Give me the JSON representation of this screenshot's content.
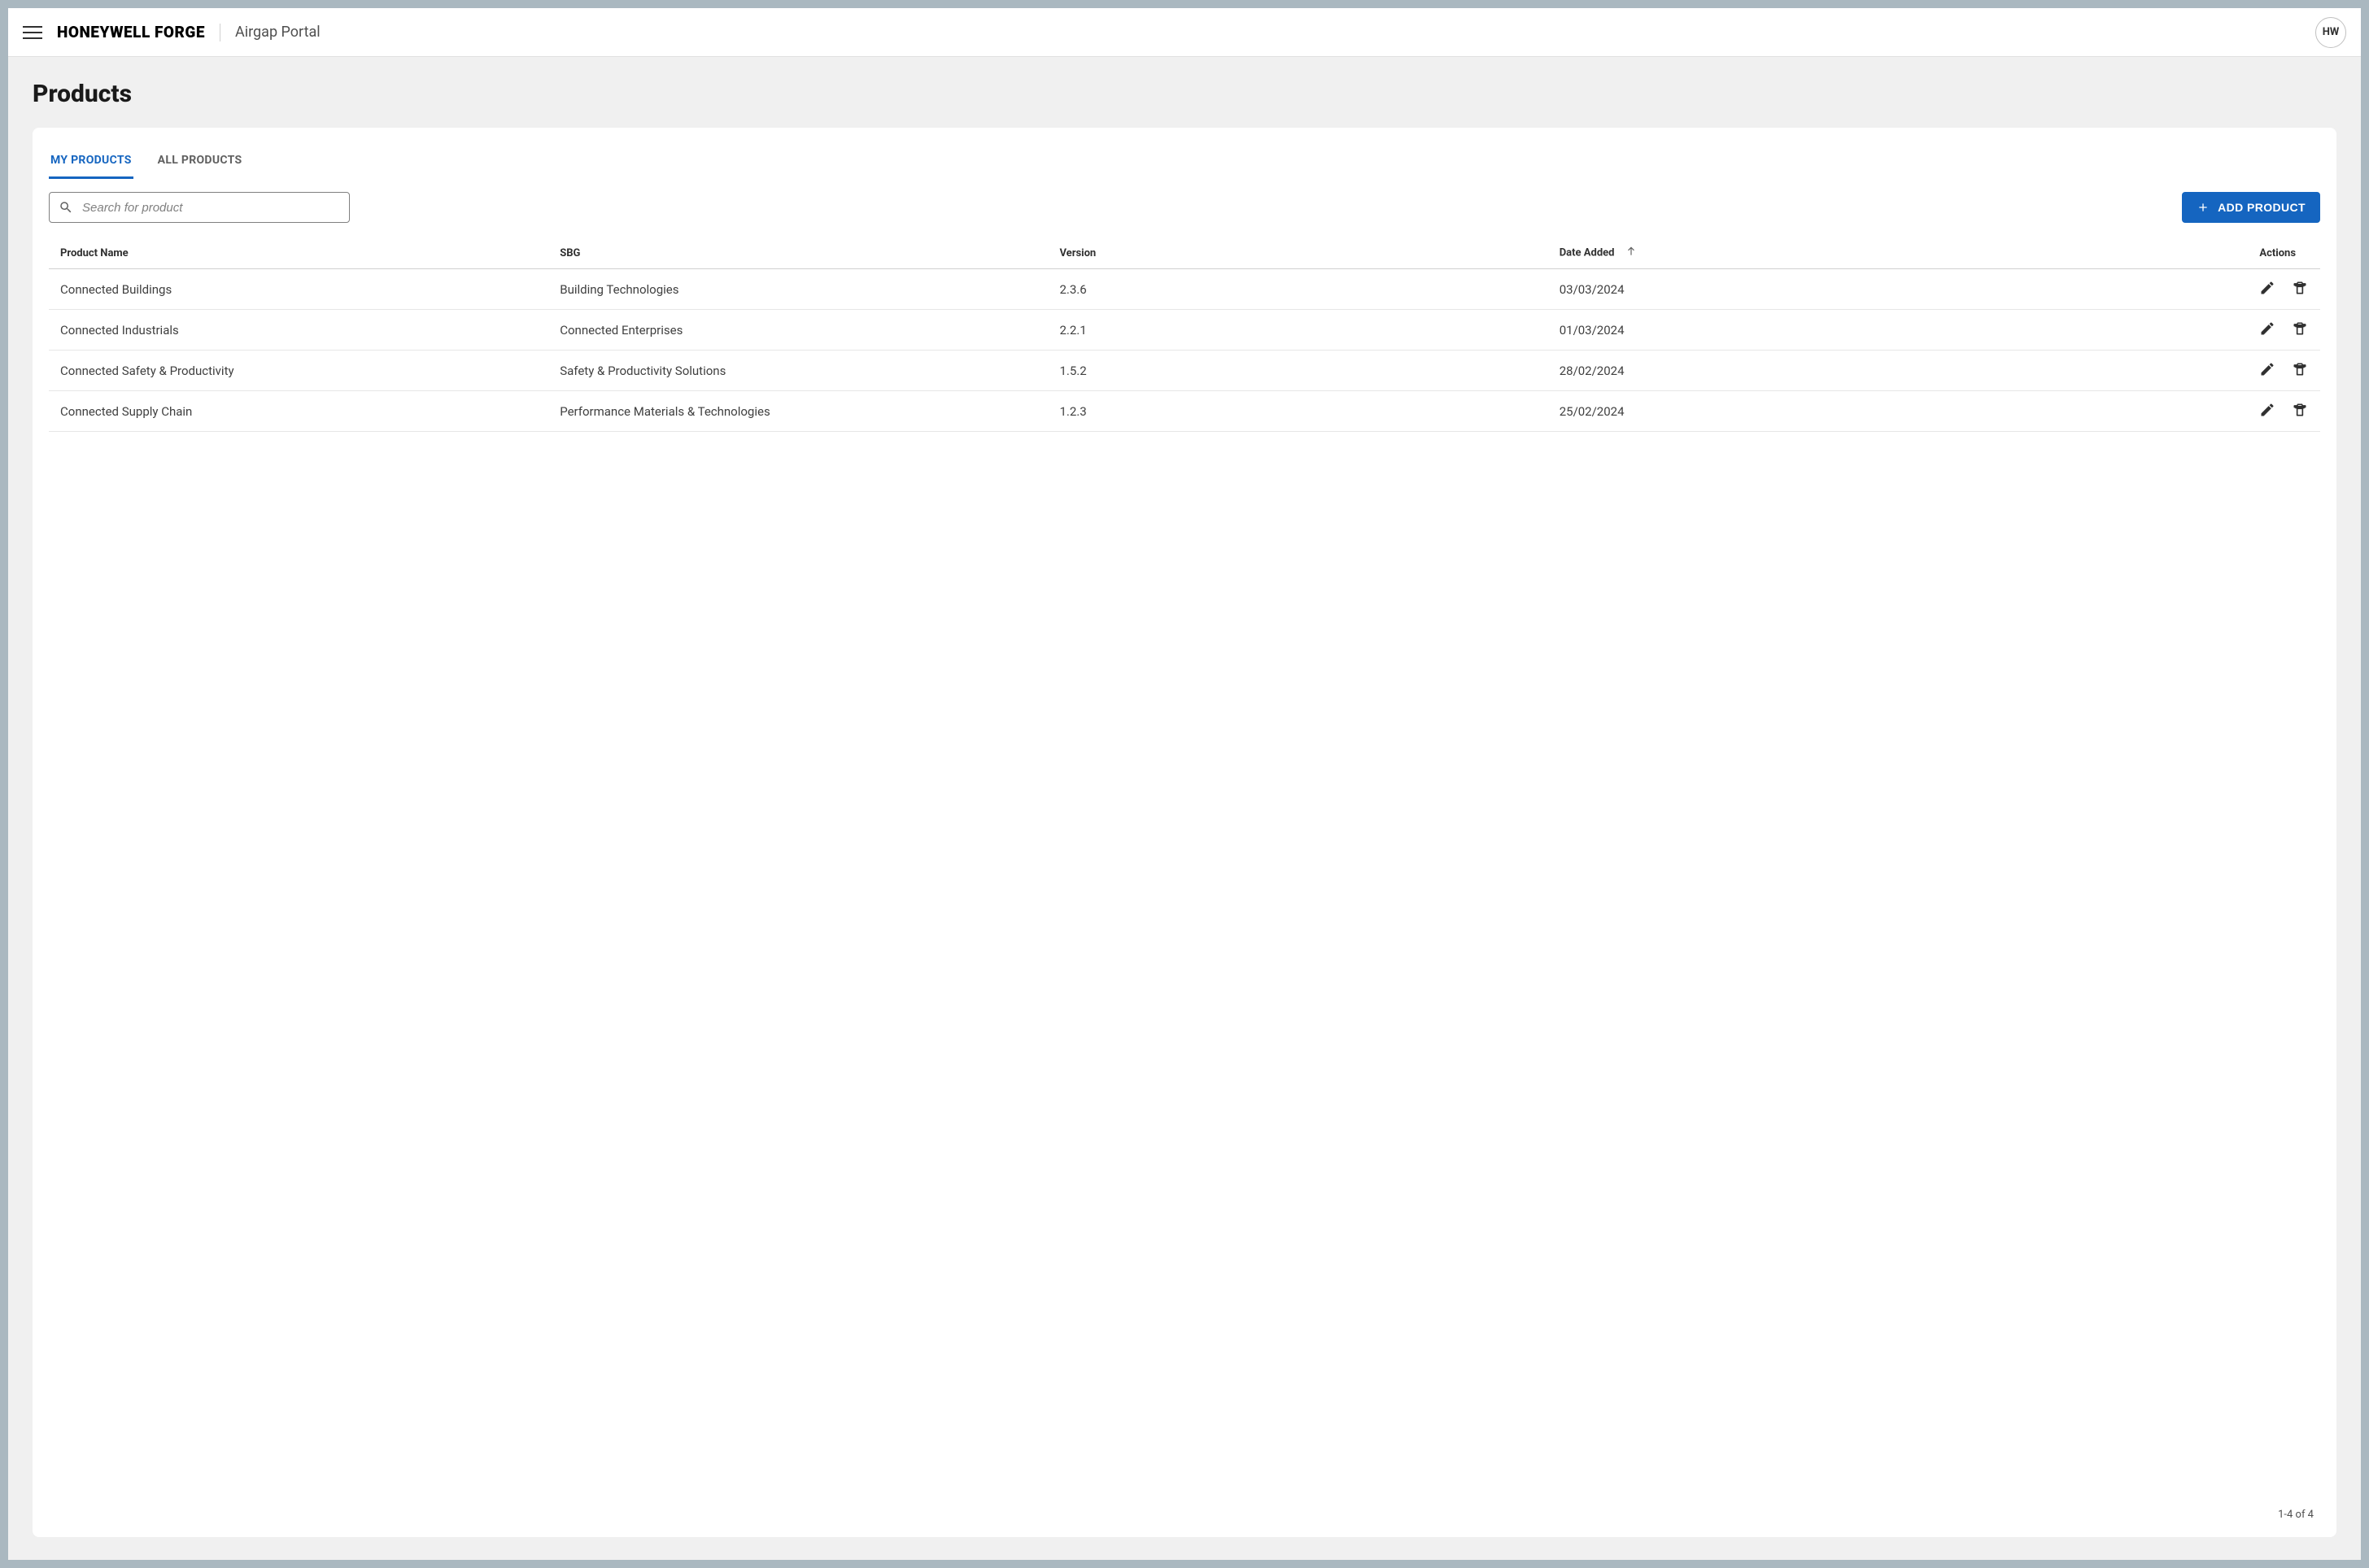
{
  "header": {
    "brand": "HONEYWELL FORGE",
    "portal": "Airgap Portal",
    "avatar_initials": "HW"
  },
  "page": {
    "title": "Products"
  },
  "tabs": [
    {
      "label": "MY PRODUCTS",
      "active": true
    },
    {
      "label": "ALL PRODUCTS",
      "active": false
    }
  ],
  "search": {
    "placeholder": "Search for product",
    "value": ""
  },
  "buttons": {
    "add_product": "ADD PRODUCT"
  },
  "table": {
    "columns": {
      "name": "Product Name",
      "sbg": "SBG",
      "version": "Version",
      "date_added": "Date Added",
      "actions": "Actions"
    },
    "sort": {
      "column": "date_added",
      "direction": "asc"
    },
    "rows": [
      {
        "name": "Connected Buildings",
        "sbg": "Building Technologies",
        "version": "2.3.6",
        "date_added": "03/03/2024"
      },
      {
        "name": "Connected Industrials",
        "sbg": "Connected Enterprises",
        "version": "2.2.1",
        "date_added": "01/03/2024"
      },
      {
        "name": "Connected Safety & Productivity",
        "sbg": "Safety & Productivity Solutions",
        "version": "1.5.2",
        "date_added": "28/02/2024"
      },
      {
        "name": "Connected Supply Chain",
        "sbg": "Performance Materials & Technologies",
        "version": "1.2.3",
        "date_added": "25/02/2024"
      }
    ],
    "pagination": "1-4 of 4"
  }
}
